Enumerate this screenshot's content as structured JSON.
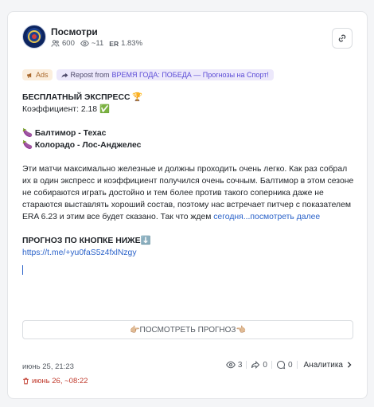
{
  "channel": {
    "name": "Посмотри",
    "subscribers": "600",
    "views": "~11",
    "er_label": "ER",
    "er_value": "1.83%"
  },
  "tags": {
    "ads": "Ads",
    "repost_prefix": "Repost from",
    "repost_source": "ВРЕМЯ ГОДА: ПОБЕДА — Прогнозы на Спорт!"
  },
  "post": {
    "title": "БЕСПЛАТНЫЙ ЭКСПРЕСС 🏆",
    "coefficient": "Коэффициент: 2.18 ✅",
    "match1": "🍆 Балтимор - Техас",
    "match2": "🍆 Колорадо - Лос-Анджелес",
    "paragraph": "Эти матчи максимально железные и должны проходить очень легко. Как раз собрал их в один экспресс и коэффициент получился очень сочным. Балтимор в этом сезоне не собираются играть достойно и тем более против такого соперника даже не стараются выставлять хороший состав, поэтому нас встречает питчер с показателем ERA 6.23 и этим все будет сказано. Так что ждем",
    "paragraph_link": "сегодня...посмотреть далее",
    "prognosis_label": "ПРОГНОЗ ПО КНОПКЕ НИЖЕ⬇️",
    "telegram_link": "https://t.me/+yu0faS5z4fxlNzgy"
  },
  "cta_button": "👉🏼ПОСМОТРЕТЬ ПРОГНОЗ👈🏼",
  "footer": {
    "published": "июнь 25, 21:23",
    "deleted": "июнь 26, ~08:22",
    "views": "3",
    "shares": "0",
    "comments": "0",
    "analytics": "Аналитика"
  },
  "colors": {
    "accent_link": "#2a62c9",
    "deleted_red": "#c0392b",
    "ads_bg": "#fbeedd",
    "repost_bg": "#ece8fb"
  }
}
